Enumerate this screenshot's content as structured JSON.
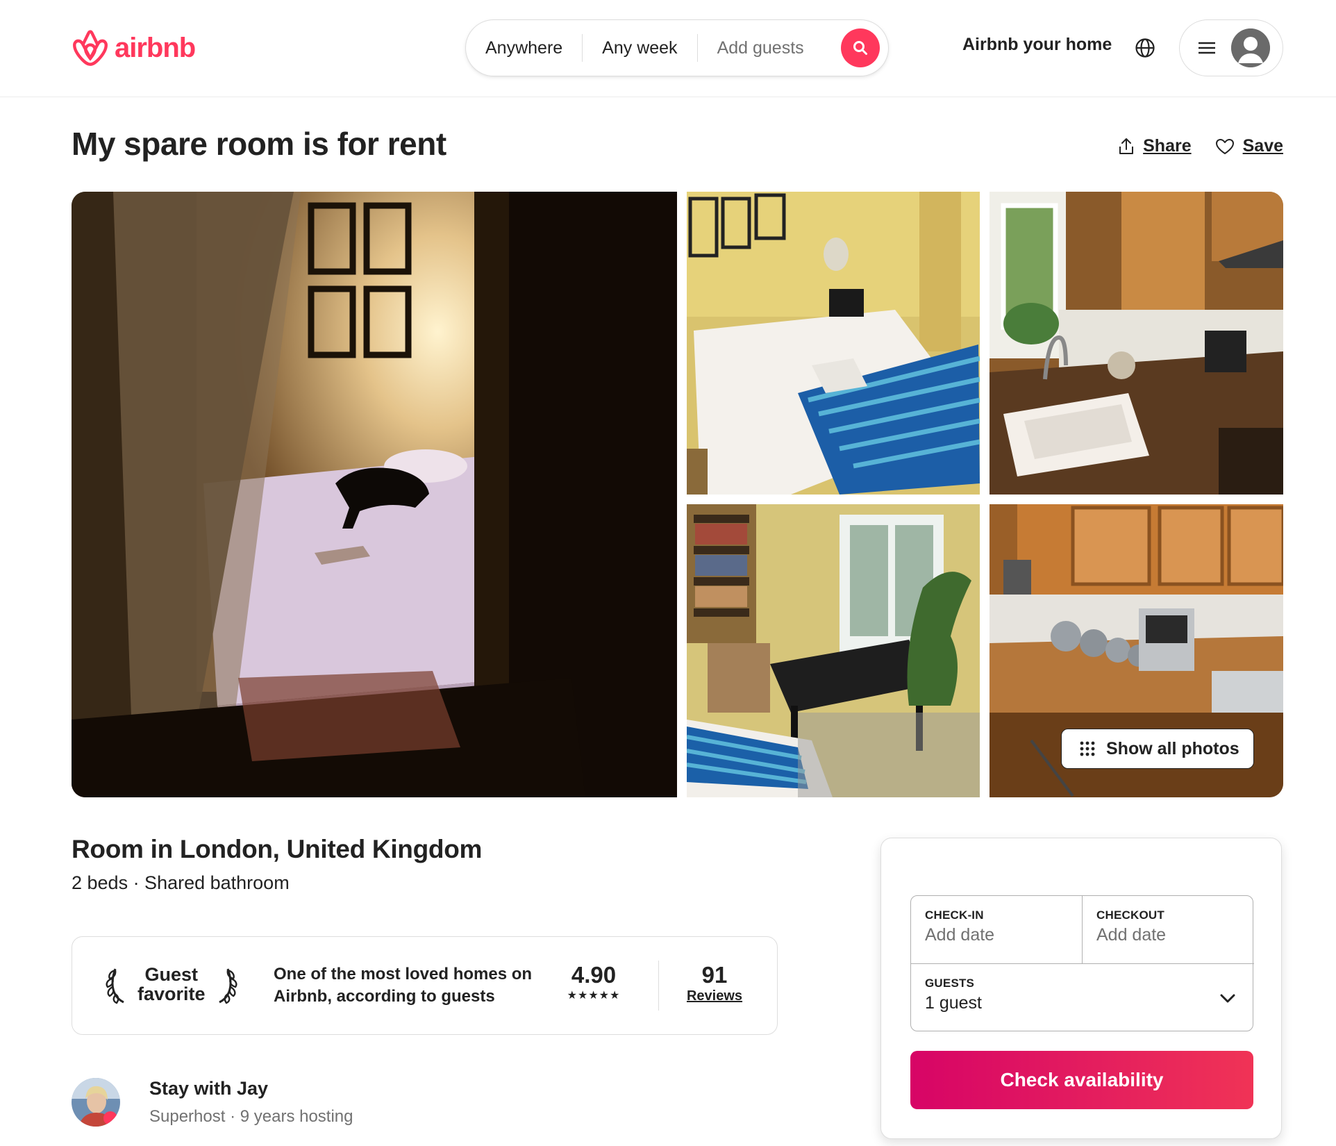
{
  "brand": {
    "name": "airbnb",
    "color": "#ff385c"
  },
  "search": {
    "where": "Anywhere",
    "when": "Any week",
    "who": "Add guests",
    "icon": "search-icon"
  },
  "header": {
    "host_link": "Airbnb your home",
    "language_icon": "globe-icon",
    "menu_icon": "menu-icon"
  },
  "listing": {
    "title": "My spare room is for rent",
    "share": "Share",
    "save": "Save",
    "show_all_photos": "Show all photos",
    "room_type": "Room in London, United Kingdom",
    "details": "2 beds · Shared bathroom"
  },
  "guest_favorite": {
    "badge_line1": "Guest",
    "badge_line2": "favorite",
    "description": "One of the most loved homes on Airbnb, according to guests",
    "rating": "4.90",
    "stars": "★★★★★",
    "reviews_count": "91",
    "reviews_label": "Reviews"
  },
  "host": {
    "name": "Stay with Jay",
    "meta": "Superhost · 9 years hosting"
  },
  "booking": {
    "checkin_label": "CHECK-IN",
    "checkin_value": "Add date",
    "checkout_label": "CHECKOUT",
    "checkout_value": "Add date",
    "guests_label": "GUESTS",
    "guests_value": "1 guest",
    "cta": "Check availability",
    "cta_color": "#e31c5f"
  }
}
